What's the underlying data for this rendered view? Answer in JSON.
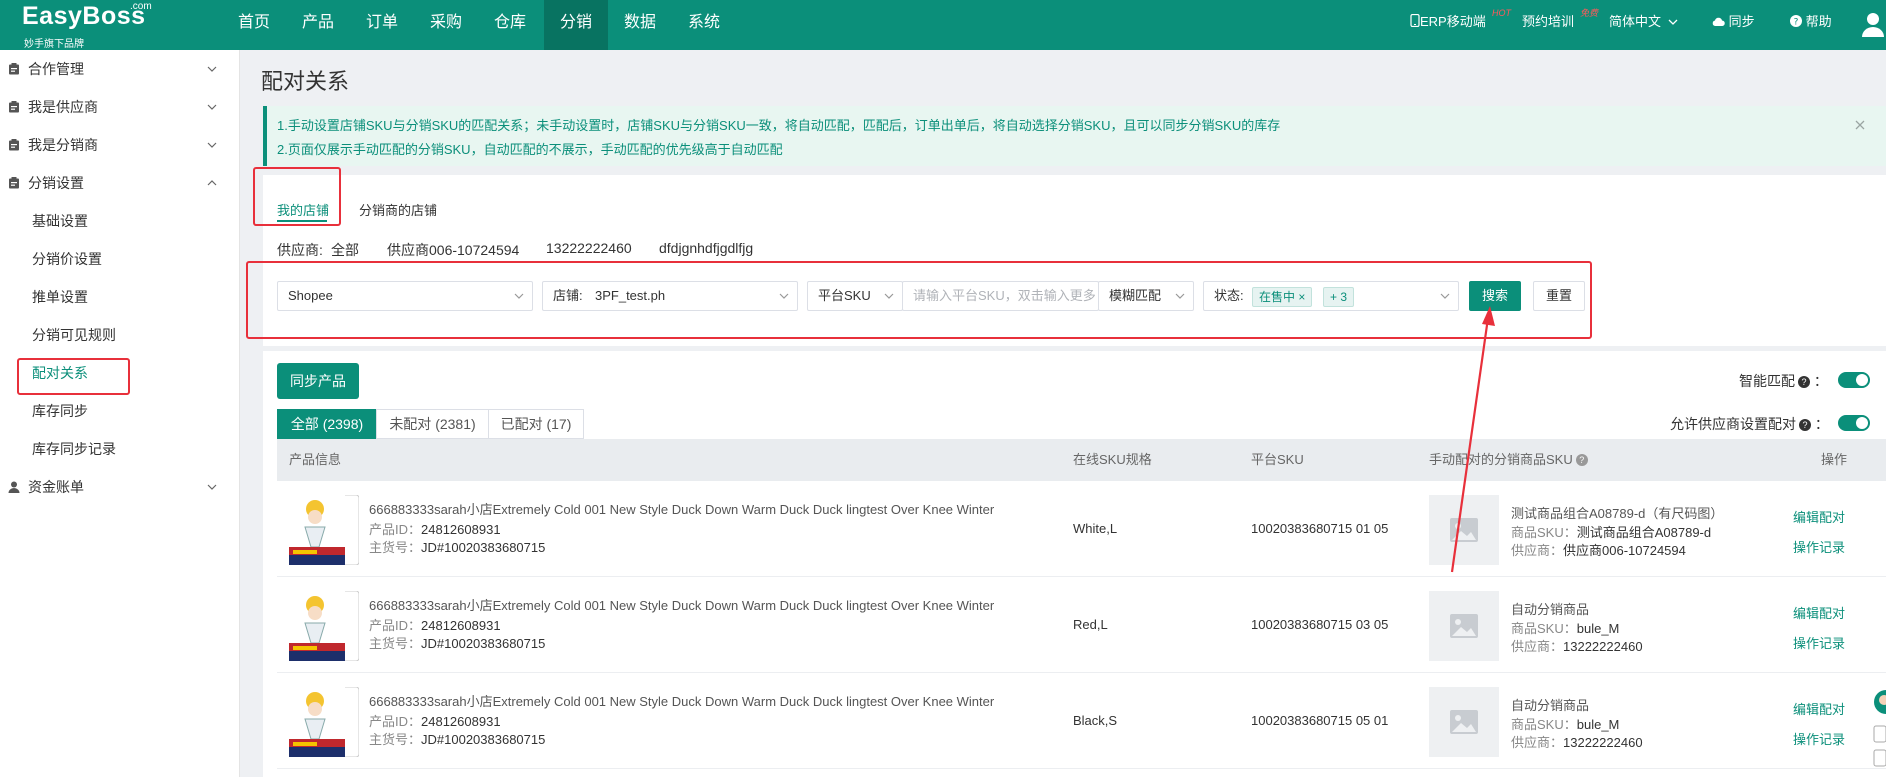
{
  "brand": {
    "name": "EasyBoss",
    "com": ".com",
    "sub": "妙手旗下品牌"
  },
  "nav": [
    "首页",
    "产品",
    "订单",
    "采购",
    "仓库",
    "分销",
    "数据",
    "系统"
  ],
  "topright": {
    "erp": "ERP移动端",
    "erp_badge": "HOT",
    "training": "预约培训",
    "training_badge": "免费",
    "language": "简体中文",
    "sync": "同步",
    "help": "帮助"
  },
  "sidebar": {
    "groups": [
      "合作管理",
      "我是供应商",
      "我是分销商",
      "分销设置"
    ],
    "subitems": [
      "基础设置",
      "分销价设置",
      "推单设置",
      "分销可见规则",
      "配对关系",
      "库存同步",
      "库存同步记录"
    ],
    "bottom_group": "资金账单"
  },
  "page_title": "配对关系",
  "notice": {
    "line1": "1.手动设置店铺SKU与分销SKU的匹配关系；未手动设置时，店铺SKU与分销SKU一致，将自动匹配，匹配后，订单出单后，将自动选择分销SKU，且可以同步分销SKU的库存",
    "line2": "2.页面仅展示手动匹配的分销SKU，自动匹配的不展示，手动匹配的优先级高于自动匹配"
  },
  "tabs": [
    "我的店铺",
    "分销商的店铺"
  ],
  "supplier": {
    "label": "供应商:",
    "options": [
      "全部",
      "供应商006-10724594",
      "13222222460",
      "dfdjgnhdfjgdlfjg"
    ]
  },
  "filters": {
    "platform": "Shopee",
    "store_label": "店铺:",
    "store_value": "3PF_test.ph",
    "sku_type": "平台SKU",
    "sku_placeholder": "请输入平台SKU，双击输入更多",
    "match_mode": "模糊匹配",
    "status_label": "状态:",
    "status_tag": "在售中",
    "status_more": "+ 3",
    "search": "搜索",
    "reset": "重置"
  },
  "sync_button": "同步产品",
  "toggles": {
    "smart_match": "智能匹配",
    "allow_supplier": "允许供应商设置配对"
  },
  "count_tabs": [
    "全部 (2398)",
    "未配对 (2381)",
    "已配对 (17)"
  ],
  "columns": [
    "产品信息",
    "在线SKU规格",
    "平台SKU",
    "手动配对的分销商品SKU",
    "操作"
  ],
  "labels": {
    "product_id": "产品ID：",
    "main_code": "主货号：",
    "goods_sku": "商品SKU：",
    "supplier": "供应商：",
    "edit": "编辑配对",
    "log": "操作记录"
  },
  "rows": [
    {
      "name": "666883333sarah小店Extremely Cold 001 New Style Duck Down Warm Duck Duck lingtest Over Knee Winter",
      "product_id": "24812608931",
      "main_code": "JD#10020383680715",
      "spec": "White,L",
      "platform_sku": "10020383680715 01 05",
      "match_name": "测试商品组合A08789-d（有尺码图）",
      "match_sku": "测试商品组合A08789-d",
      "match_supplier": "供应商006-10724594"
    },
    {
      "name": "666883333sarah小店Extremely Cold 001 New Style Duck Down Warm Duck Duck lingtest Over Knee Winter",
      "product_id": "24812608931",
      "main_code": "JD#10020383680715",
      "spec": "Red,L",
      "platform_sku": "10020383680715 03 05",
      "match_name": "自动分销商品",
      "match_sku": "bule_M",
      "match_supplier": "13222222460"
    },
    {
      "name": "666883333sarah小店Extremely Cold 001 New Style Duck Down Warm Duck Duck lingtest Over Knee Winter",
      "product_id": "24812608931",
      "main_code": "JD#10020383680715",
      "spec": "Black,S",
      "platform_sku": "10020383680715 05 01",
      "match_name": "自动分销商品",
      "match_sku": "bule_M",
      "match_supplier": "13222222460"
    }
  ],
  "colors": {
    "accent": "#0b8f7a",
    "annotation": "#e8303b"
  },
  "icons": {
    "sidebar_group": "clipboard-icon",
    "account": "user-icon",
    "placeholder": "image-placeholder-icon"
  }
}
